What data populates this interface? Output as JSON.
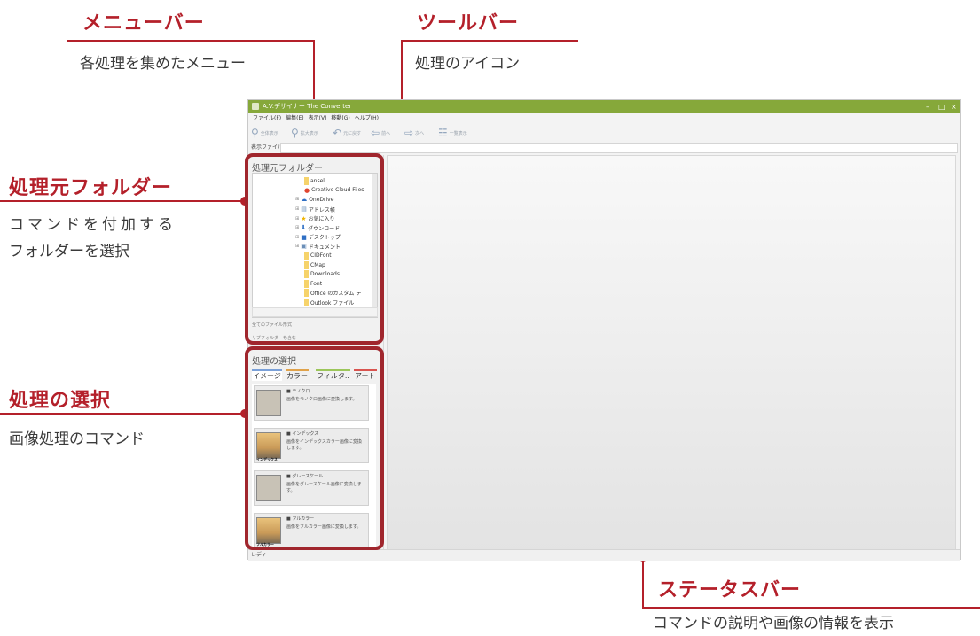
{
  "callouts": {
    "menubar": {
      "title": "メニューバー",
      "desc": "各処理を集めたメニュー"
    },
    "toolbar": {
      "title": "ツールバー",
      "desc": "処理のアイコン"
    },
    "source_folder": {
      "title": "処理元フォルダー",
      "desc_line1": "コマンドを付加する",
      "desc_line2": "フォルダーを選択"
    },
    "process_select": {
      "title": "処理の選択",
      "desc": "画像処理のコマンド"
    },
    "statusbar": {
      "title": "ステータスバー",
      "desc": "コマンドの説明や画像の情報を表示"
    }
  },
  "app": {
    "title": "A.V.デザイナー The Converter",
    "window_controls": {
      "minimize": "–",
      "maximize": "□",
      "close": "×"
    },
    "menu": [
      "ファイル(F)",
      "編集(E)",
      "表示(V)",
      "移動(G)",
      "ヘルプ(H)"
    ],
    "toolbar": [
      {
        "icon": "magnifier-icon",
        "glyph": "⚲",
        "label": "全体表示"
      },
      {
        "icon": "zoom-icon",
        "glyph": "⚲",
        "label": "拡大表示"
      },
      {
        "icon": "undo-icon",
        "glyph": "↶",
        "label": "元に戻す"
      },
      {
        "icon": "back-icon",
        "glyph": "⇦",
        "label": "前へ"
      },
      {
        "icon": "forward-icon",
        "glyph": "⇨",
        "label": "次へ"
      },
      {
        "icon": "list-icon",
        "glyph": "☷",
        "label": "一覧表示"
      }
    ],
    "filebar_label": "表示ファイル名",
    "left_panel": {
      "folder_header": "処理元フォルダー",
      "tree": [
        {
          "label": "ansel",
          "indent": 3,
          "type": "folder"
        },
        {
          "label": "Creative Cloud Files",
          "indent": 3,
          "type": "cc"
        },
        {
          "label": "OneDrive",
          "indent": 2,
          "type": "cloud"
        },
        {
          "label": "アドレス帳",
          "indent": 2,
          "type": "contacts"
        },
        {
          "label": "お気に入り",
          "indent": 2,
          "type": "star"
        },
        {
          "label": "ダウンロード",
          "indent": 2,
          "type": "download"
        },
        {
          "label": "デスクトップ",
          "indent": 2,
          "type": "desktop"
        },
        {
          "label": "ドキュメント",
          "indent": 2,
          "type": "docs"
        },
        {
          "label": "CIDFont",
          "indent": 3,
          "type": "folder"
        },
        {
          "label": "CMap",
          "indent": 3,
          "type": "folder"
        },
        {
          "label": "Downloads",
          "indent": 3,
          "type": "folder"
        },
        {
          "label": "Font",
          "indent": 3,
          "type": "folder"
        },
        {
          "label": "Office のカスタム テ",
          "indent": 3,
          "type": "folder"
        },
        {
          "label": "Outlook ファイル",
          "indent": 3,
          "type": "folder"
        }
      ],
      "file_format": "全てのファイル形式",
      "subfolder": "サブフォルダーも含む",
      "process_header": "処理の選択",
      "tabs": [
        "イメージ",
        "カラー",
        "フィルタ..",
        "アート"
      ],
      "tab_colors": [
        "#7aa0d8",
        "#e0a24a",
        "#9cc65a",
        "#d9544f"
      ],
      "cards": [
        {
          "title": "モノクロ",
          "desc": "画像をモノクロ画像に変換します。",
          "label": ""
        },
        {
          "title": "インデックス",
          "desc": "画像をインデックスカラー画像に変換します。",
          "label": "インデックス"
        },
        {
          "title": "グレースケール",
          "desc": "画像をグレースケール画像に変換します。",
          "label": ""
        },
        {
          "title": "フルカラー",
          "desc": "画像をフルカラー画像に変換します。",
          "label": "フルカラー"
        }
      ]
    },
    "status_text": "レディ"
  },
  "colors": {
    "accent": "#b4202a",
    "titlebar": "#86a83a",
    "highlight_box": "#a0262d"
  }
}
